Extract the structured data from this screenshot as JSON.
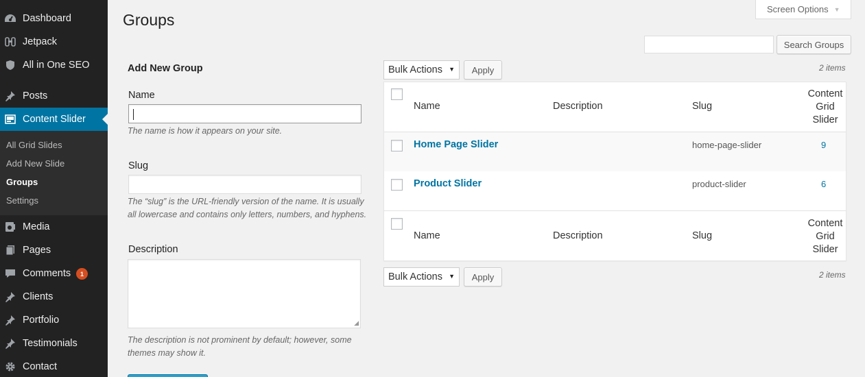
{
  "sidebar": {
    "menu": [
      {
        "label": "Dashboard",
        "icon": "dashboard-icon"
      },
      {
        "label": "Jetpack",
        "icon": "jetpack-icon"
      },
      {
        "label": "All in One SEO",
        "icon": "shield-icon"
      },
      {
        "label": "Posts",
        "icon": "pin-icon"
      },
      {
        "label": "Content Slider",
        "icon": "slider-icon"
      },
      {
        "label": "Media",
        "icon": "media-icon"
      },
      {
        "label": "Pages",
        "icon": "pages-icon"
      },
      {
        "label": "Comments",
        "icon": "comments-icon",
        "badge": "1"
      },
      {
        "label": "Clients",
        "icon": "pin-icon"
      },
      {
        "label": "Portfolio",
        "icon": "pin-icon"
      },
      {
        "label": "Testimonials",
        "icon": "pin-icon"
      },
      {
        "label": "Contact",
        "icon": "gear-icon"
      }
    ],
    "submenu": [
      "All Grid Slides",
      "Add New Slide",
      "Groups",
      "Settings"
    ]
  },
  "header": {
    "title": "Groups",
    "screen_options": "Screen Options"
  },
  "search": {
    "value": "",
    "button": "Search Groups"
  },
  "form": {
    "heading": "Add New Group",
    "name_label": "Name",
    "name_value": "",
    "name_hint": "The name is how it appears on your site.",
    "slug_label": "Slug",
    "slug_value": "",
    "slug_hint_1": "The “slug” is the URL-friendly version of the name. It is usually",
    "slug_hint_2": "all lowercase and contains only letters, numbers, and hyphens.",
    "description_label": "Description",
    "description_value": "",
    "description_hint_1": "The description is not prominent by default; however, some",
    "description_hint_2": "themes may show it."
  },
  "table": {
    "bulk_actions": "Bulk Actions",
    "apply": "Apply",
    "items_count": "2 items",
    "columns": {
      "name": "Name",
      "description": "Description",
      "slug": "Slug",
      "cgs_1": "Content",
      "cgs_2": "Grid",
      "cgs_3": "Slider"
    },
    "rows": [
      {
        "name": "Home Page Slider",
        "description": "",
        "slug": "home-page-slider",
        "count": "9"
      },
      {
        "name": "Product Slider",
        "description": "",
        "slug": "product-slider",
        "count": "6"
      }
    ]
  },
  "colors": {
    "sidebar_bg": "#222222",
    "active_menu": "#0074a2",
    "link": "#0074a2",
    "badge": "#d54e21"
  }
}
